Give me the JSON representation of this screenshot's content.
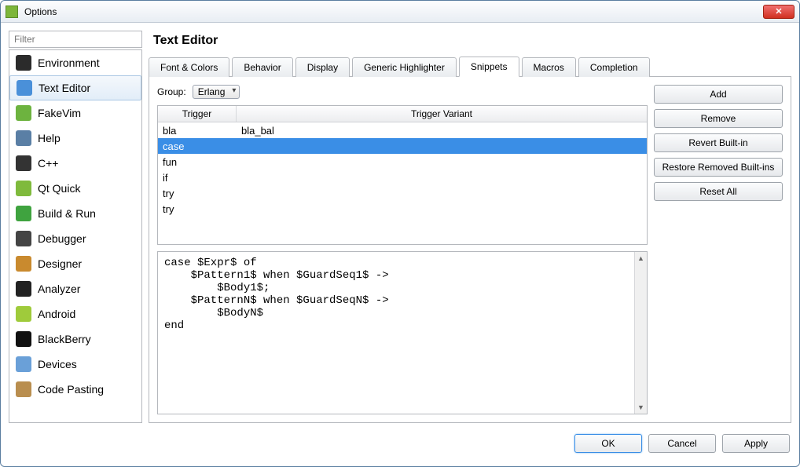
{
  "window": {
    "title": "Options"
  },
  "sidebar": {
    "filter_placeholder": "Filter",
    "items": [
      {
        "label": "Environment",
        "iconColor": "#2b2b2b"
      },
      {
        "label": "Text Editor",
        "iconColor": "#4a90d9",
        "selected": true
      },
      {
        "label": "FakeVim",
        "iconColor": "#6db33f"
      },
      {
        "label": "Help",
        "iconColor": "#5a7fa5"
      },
      {
        "label": "C++",
        "iconColor": "#333"
      },
      {
        "label": "Qt Quick",
        "iconColor": "#7fba3c"
      },
      {
        "label": "Build & Run",
        "iconColor": "#3fa33f"
      },
      {
        "label": "Debugger",
        "iconColor": "#444"
      },
      {
        "label": "Designer",
        "iconColor": "#c98a2e"
      },
      {
        "label": "Analyzer",
        "iconColor": "#222"
      },
      {
        "label": "Android",
        "iconColor": "#9fcb3b"
      },
      {
        "label": "BlackBerry",
        "iconColor": "#111"
      },
      {
        "label": "Devices",
        "iconColor": "#6aa0d8"
      },
      {
        "label": "Code Pasting",
        "iconColor": "#b98e4f"
      }
    ]
  },
  "page": {
    "title": "Text Editor",
    "tabs": [
      {
        "label": "Font & Colors"
      },
      {
        "label": "Behavior"
      },
      {
        "label": "Display"
      },
      {
        "label": "Generic Highlighter"
      },
      {
        "label": "Snippets",
        "active": true
      },
      {
        "label": "Macros"
      },
      {
        "label": "Completion"
      }
    ]
  },
  "snippets": {
    "group_label": "Group:",
    "group_value": "Erlang",
    "columns": {
      "trigger": "Trigger",
      "variant": "Trigger Variant"
    },
    "rows": [
      {
        "trigger": "bla",
        "variant": "bla_bal"
      },
      {
        "trigger": "case",
        "variant": "",
        "selected": true
      },
      {
        "trigger": "fun",
        "variant": ""
      },
      {
        "trigger": "if",
        "variant": ""
      },
      {
        "trigger": "try",
        "variant": ""
      },
      {
        "trigger": "try",
        "variant": ""
      }
    ],
    "code": "case $Expr$ of\n    $Pattern1$ when $GuardSeq1$ ->\n        $Body1$;\n    $PatternN$ when $GuardSeqN$ ->\n        $BodyN$\nend"
  },
  "buttons": {
    "add": "Add",
    "remove": "Remove",
    "revert": "Revert Built-in",
    "restore": "Restore Removed Built-ins",
    "reset": "Reset All"
  },
  "footer": {
    "ok": "OK",
    "cancel": "Cancel",
    "apply": "Apply"
  }
}
